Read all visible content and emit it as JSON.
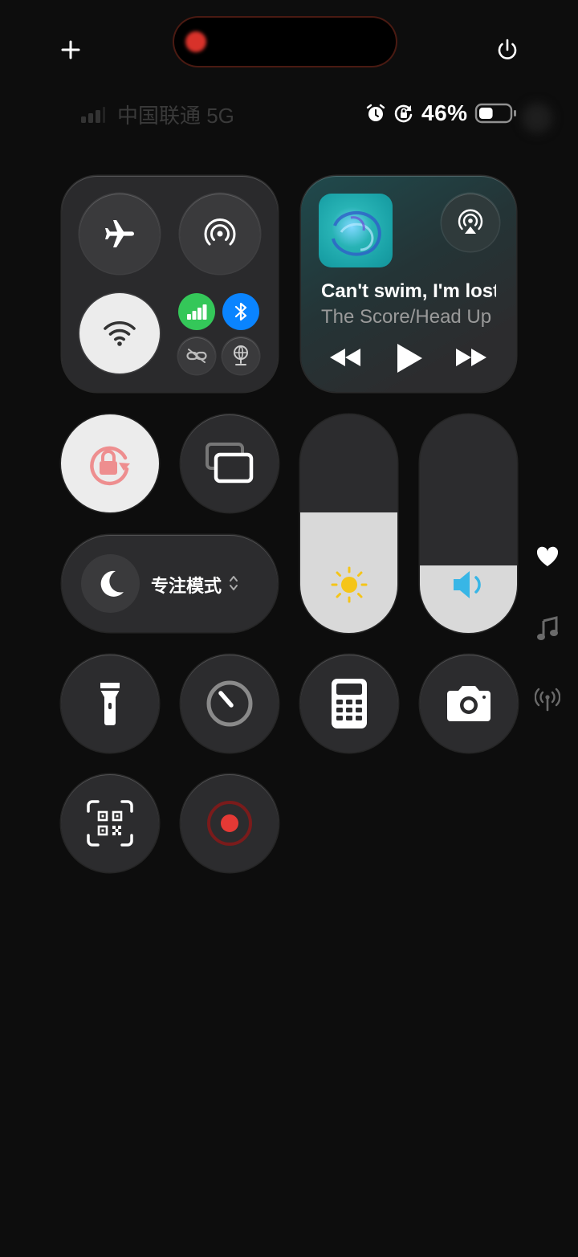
{
  "status": {
    "carrier": "中国联通 5G",
    "battery_percent": "46%",
    "battery_level": 0.46
  },
  "media": {
    "song_title": "Can't swim, I'm lost",
    "artist": "The Score/Head Up"
  },
  "focus": {
    "label": "专注模式"
  },
  "sliders": {
    "brightness_level": 0.55,
    "volume_level": 0.31
  },
  "colors": {
    "cellular_green": "#34c759",
    "bluetooth_blue": "#0a84ff",
    "record_red": "#e53935",
    "lock_pink": "#ee8e8f",
    "sun_yellow": "#f5c518",
    "volume_blue": "#38b6e6",
    "album_teal": "#19b4b5"
  },
  "icons": [
    "add-icon",
    "power-icon",
    "signal-bars-icon",
    "alarm-icon",
    "rotation-lock-icon",
    "battery-icon",
    "airplane-icon",
    "airdrop-icon",
    "wifi-icon",
    "cellular-icon",
    "bluetooth-icon",
    "personal-hotspot-icon",
    "vpn-icon",
    "airplay-icon",
    "rewind-icon",
    "play-icon",
    "forward-icon",
    "screen-mirror-icon",
    "moon-icon",
    "sun-icon",
    "speaker-icon",
    "heart-icon",
    "music-note-icon",
    "antenna-icon",
    "flashlight-icon",
    "timer-icon",
    "calculator-icon",
    "camera-icon",
    "qr-scan-icon",
    "screen-record-icon"
  ]
}
